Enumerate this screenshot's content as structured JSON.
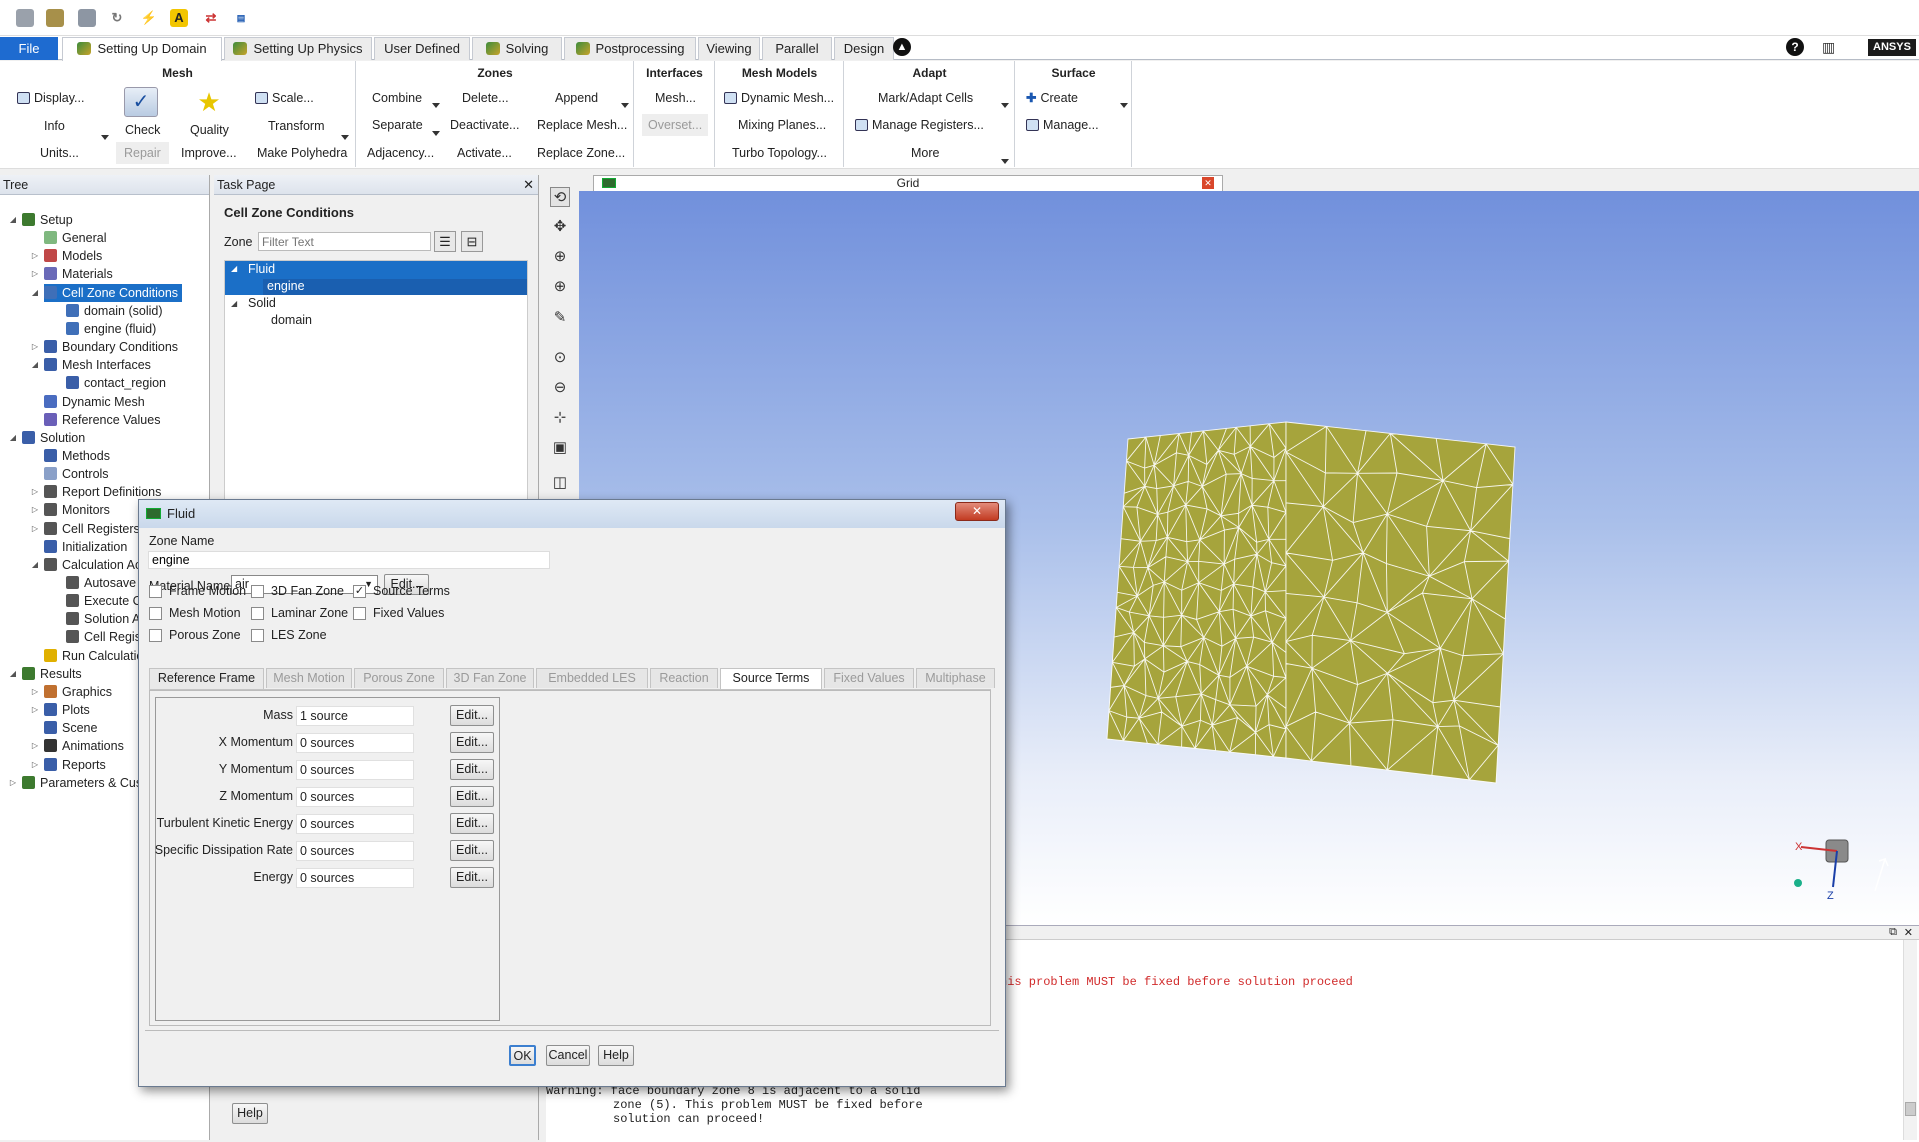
{
  "brand": "ANSYS",
  "tabs": [
    {
      "label": "File"
    },
    {
      "label": "Setting Up Domain"
    },
    {
      "label": "Setting Up Physics"
    },
    {
      "label": "User Defined"
    },
    {
      "label": "Solving"
    },
    {
      "label": "Postprocessing"
    },
    {
      "label": "Viewing"
    },
    {
      "label": "Parallel"
    },
    {
      "label": "Design"
    }
  ],
  "ribbon": {
    "mesh": {
      "title": "Mesh",
      "display": "Display...",
      "info": "Info",
      "units": "Units...",
      "check": "Check",
      "repair": "Repair",
      "quality": "Quality",
      "improve": "Improve...",
      "scale": "Scale...",
      "transform": "Transform",
      "make_polyhedra": "Make Polyhedra"
    },
    "zones": {
      "title": "Zones",
      "combine": "Combine",
      "separate": "Separate",
      "adjacency": "Adjacency...",
      "delete": "Delete...",
      "deactivate": "Deactivate...",
      "activate": "Activate...",
      "append": "Append",
      "replace_mesh": "Replace Mesh...",
      "replace_zone": "Replace Zone..."
    },
    "interfaces": {
      "title": "Interfaces",
      "mesh": "Mesh...",
      "overset": "Overset..."
    },
    "mesh_models": {
      "title": "Mesh Models",
      "dynamic_mesh": "Dynamic Mesh...",
      "mixing_planes": "Mixing Planes...",
      "turbo_topology": "Turbo Topology..."
    },
    "adapt": {
      "title": "Adapt",
      "mark_adapt": "Mark/Adapt Cells",
      "manage_registers": "Manage Registers...",
      "more": "More"
    },
    "surface": {
      "title": "Surface",
      "create": "Create",
      "manage": "Manage..."
    }
  },
  "tree": {
    "title": "Tree",
    "items": [
      {
        "label": "Setup"
      },
      {
        "label": "General"
      },
      {
        "label": "Models"
      },
      {
        "label": "Materials"
      },
      {
        "label": "Cell Zone Conditions"
      },
      {
        "label": "domain (solid)"
      },
      {
        "label": "engine (fluid)"
      },
      {
        "label": "Boundary Conditions"
      },
      {
        "label": "Mesh Interfaces"
      },
      {
        "label": "contact_region"
      },
      {
        "label": "Dynamic Mesh"
      },
      {
        "label": "Reference Values"
      },
      {
        "label": "Solution"
      },
      {
        "label": "Methods"
      },
      {
        "label": "Controls"
      },
      {
        "label": "Report Definitions"
      },
      {
        "label": "Monitors"
      },
      {
        "label": "Cell Registers"
      },
      {
        "label": "Initialization"
      },
      {
        "label": "Calculation Ac"
      },
      {
        "label": "Autosave"
      },
      {
        "label": "Execute Co"
      },
      {
        "label": "Solution An"
      },
      {
        "label": "Cell Registe"
      },
      {
        "label": "Run Calculatio"
      },
      {
        "label": "Results"
      },
      {
        "label": "Graphics"
      },
      {
        "label": "Plots"
      },
      {
        "label": "Scene"
      },
      {
        "label": "Animations"
      },
      {
        "label": "Reports"
      },
      {
        "label": "Parameters & Cus"
      }
    ]
  },
  "task": {
    "header": "Task Page",
    "title": "Cell Zone Conditions",
    "zone_label": "Zone",
    "filter_placeholder": "Filter Text",
    "zones": [
      {
        "label": "Fluid"
      },
      {
        "label": "engine"
      },
      {
        "label": "Solid"
      },
      {
        "label": "domain"
      }
    ],
    "help": "Help"
  },
  "graphics": {
    "tab_title": "Grid",
    "mesh_color": "#a6a43c",
    "axis_x": "X",
    "axis_z": "Z"
  },
  "console": {
    "line1": "his problem MUST be fixed before solution proceed",
    "line2": "Warning: face boundary zone 8 is adjacent to a solid",
    "line3": "zone (5). This problem MUST be fixed before",
    "line4": "solution can proceed!"
  },
  "dialog": {
    "title": "Fluid",
    "zone_name_label": "Zone Name",
    "zone_name": "engine",
    "material_label": "Material Name",
    "material": "air",
    "edit": "Edit...",
    "checks": [
      {
        "label": "Frame Motion",
        "checked": false
      },
      {
        "label": "3D Fan Zone",
        "checked": false
      },
      {
        "label": "Source Terms",
        "checked": true
      },
      {
        "label": "Mesh Motion",
        "checked": false
      },
      {
        "label": "Laminar Zone",
        "checked": false
      },
      {
        "label": "Fixed Values",
        "checked": false
      },
      {
        "label": "Porous Zone",
        "checked": false
      },
      {
        "label": "LES Zone",
        "checked": false
      }
    ],
    "tabs": [
      {
        "label": "Reference Frame"
      },
      {
        "label": "Mesh Motion"
      },
      {
        "label": "Porous Zone"
      },
      {
        "label": "3D Fan Zone"
      },
      {
        "label": "Embedded LES"
      },
      {
        "label": "Reaction"
      },
      {
        "label": "Source Terms"
      },
      {
        "label": "Fixed Values"
      },
      {
        "label": "Multiphase"
      }
    ],
    "sources": [
      {
        "label": "Mass",
        "value": "1 source"
      },
      {
        "label": "X Momentum",
        "value": "0 sources"
      },
      {
        "label": "Y Momentum",
        "value": "0 sources"
      },
      {
        "label": "Z Momentum",
        "value": "0 sources"
      },
      {
        "label": "Turbulent Kinetic Energy",
        "value": "0 sources"
      },
      {
        "label": "Specific Dissipation Rate",
        "value": "0 sources"
      },
      {
        "label": "Energy",
        "value": "0 sources"
      }
    ],
    "ok": "OK",
    "cancel": "Cancel",
    "help": "Help"
  }
}
